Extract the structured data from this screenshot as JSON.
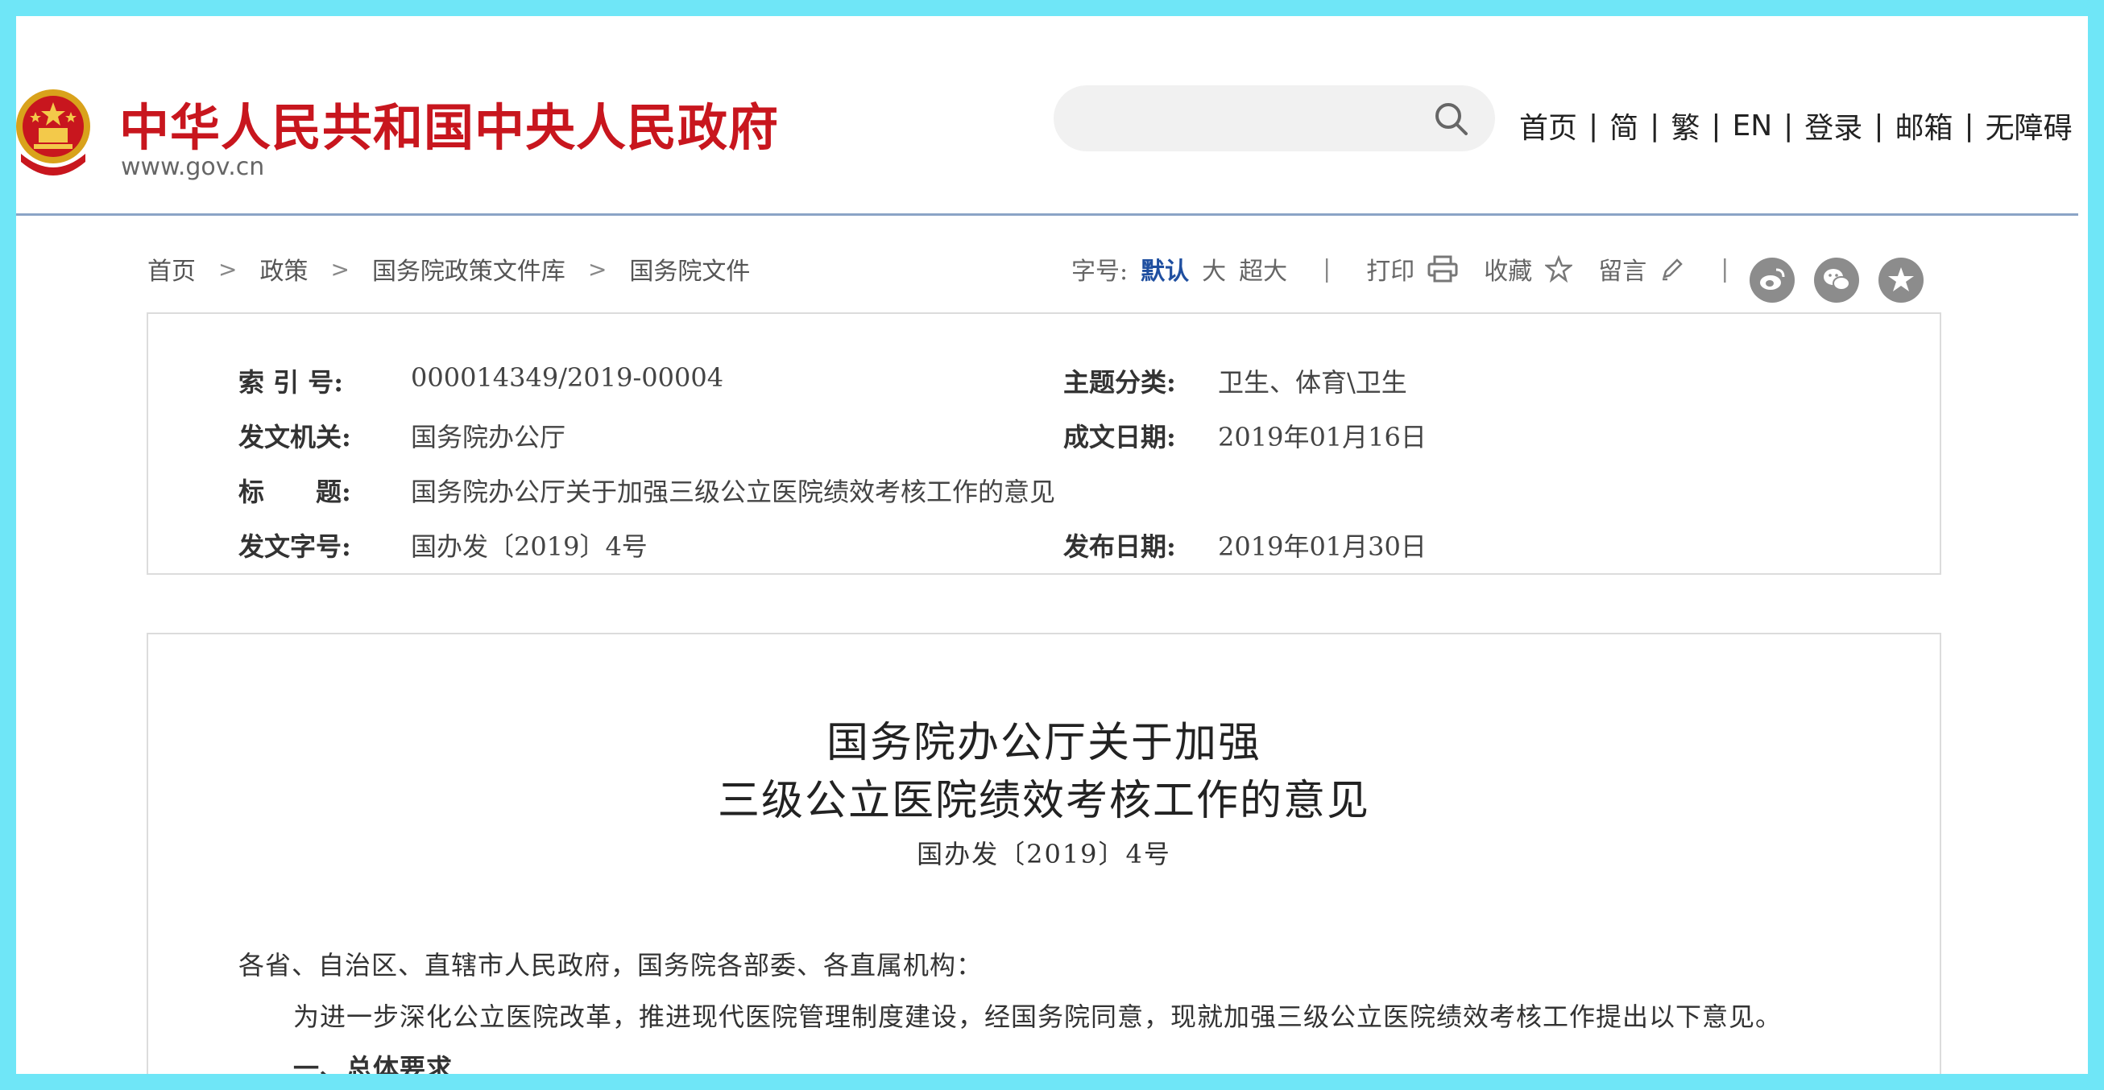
{
  "header": {
    "site_title": "中华人民共和国中央人民政府",
    "site_url": "www.gov.cn",
    "search_placeholder": "",
    "nav": [
      "首页",
      "简",
      "繁",
      "EN",
      "登录",
      "邮箱",
      "无障碍"
    ],
    "nav_separator": "|"
  },
  "breadcrumb": [
    "首页",
    "政策",
    "国务院政策文件库",
    "国务院文件"
  ],
  "tools": {
    "font_size_label": "字号:",
    "font_default": "默认",
    "font_large": "大",
    "font_xlarge": "超大",
    "divider": "|",
    "print": "打印",
    "favorite": "收藏",
    "comment": "留言"
  },
  "social_icons": [
    "weibo-icon",
    "wechat-icon",
    "qzone-icon"
  ],
  "meta": {
    "index_label": "索 引 号:",
    "index_value": "000014349/2019-00004",
    "topic_label": "主题分类:",
    "topic_value": "卫生、体育\\卫生",
    "issuer_label": "发文机关:",
    "issuer_value": "国务院办公厅",
    "written_label": "成文日期:",
    "written_value": "2019年01月16日",
    "title_label": "标　　题:",
    "title_value": "国务院办公厅关于加强三级公立医院绩效考核工作的意见",
    "docno_label": "发文字号:",
    "docno_value": "国办发〔2019〕4号",
    "published_label": "发布日期:",
    "published_value": "2019年01月30日"
  },
  "document": {
    "title_line1": "国务院办公厅关于加强",
    "title_line2": "三级公立医院绩效考核工作的意见",
    "doc_number": "国办发〔2019〕4号",
    "salutation": "各省、自治区、直辖市人民政府，国务院各部委、各直属机构：",
    "para1": "为进一步深化公立医院改革，推进现代医院管理制度建设，经国务院同意，现就加强三级公立医院绩效考核工作提出以下意见。",
    "section1": "一、总体要求"
  },
  "colors": {
    "brand_red": "#c8161e",
    "header_line": "#8ba4c6",
    "active_blue": "#1f4fa0",
    "frame_cyan": "#6fe6f7"
  }
}
